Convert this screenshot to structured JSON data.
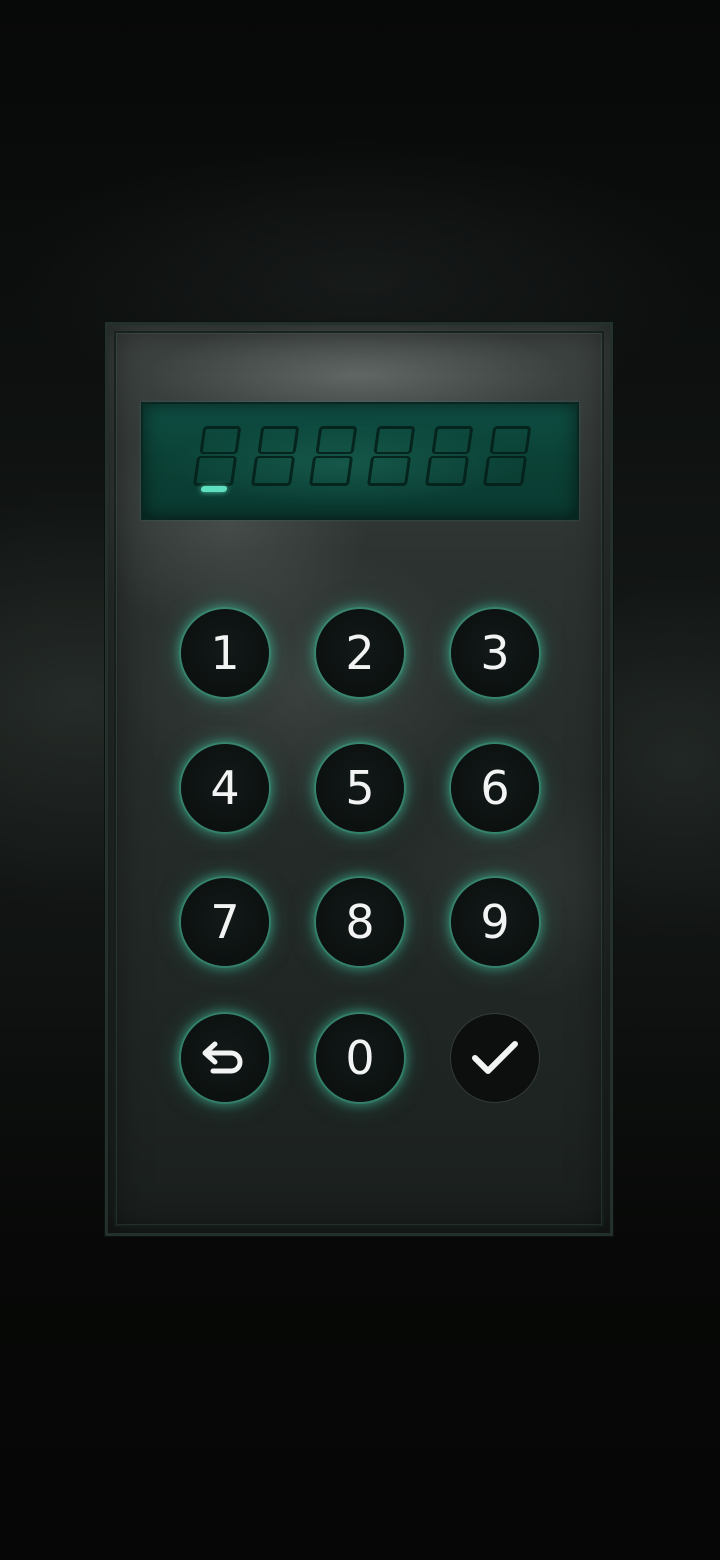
{
  "keypad": {
    "display_digits": 6,
    "cursor_position": 1,
    "keys": [
      {
        "label": "1"
      },
      {
        "label": "2"
      },
      {
        "label": "3"
      },
      {
        "label": "4"
      },
      {
        "label": "5"
      },
      {
        "label": "6"
      },
      {
        "label": "7"
      },
      {
        "label": "8"
      },
      {
        "label": "9"
      },
      {
        "icon": "backspace-icon"
      },
      {
        "label": "0"
      },
      {
        "icon": "checkmark-icon"
      }
    ]
  },
  "colors": {
    "display": "#0b4136",
    "glow": "#46be9b",
    "cursor": "#5ee0c0"
  }
}
